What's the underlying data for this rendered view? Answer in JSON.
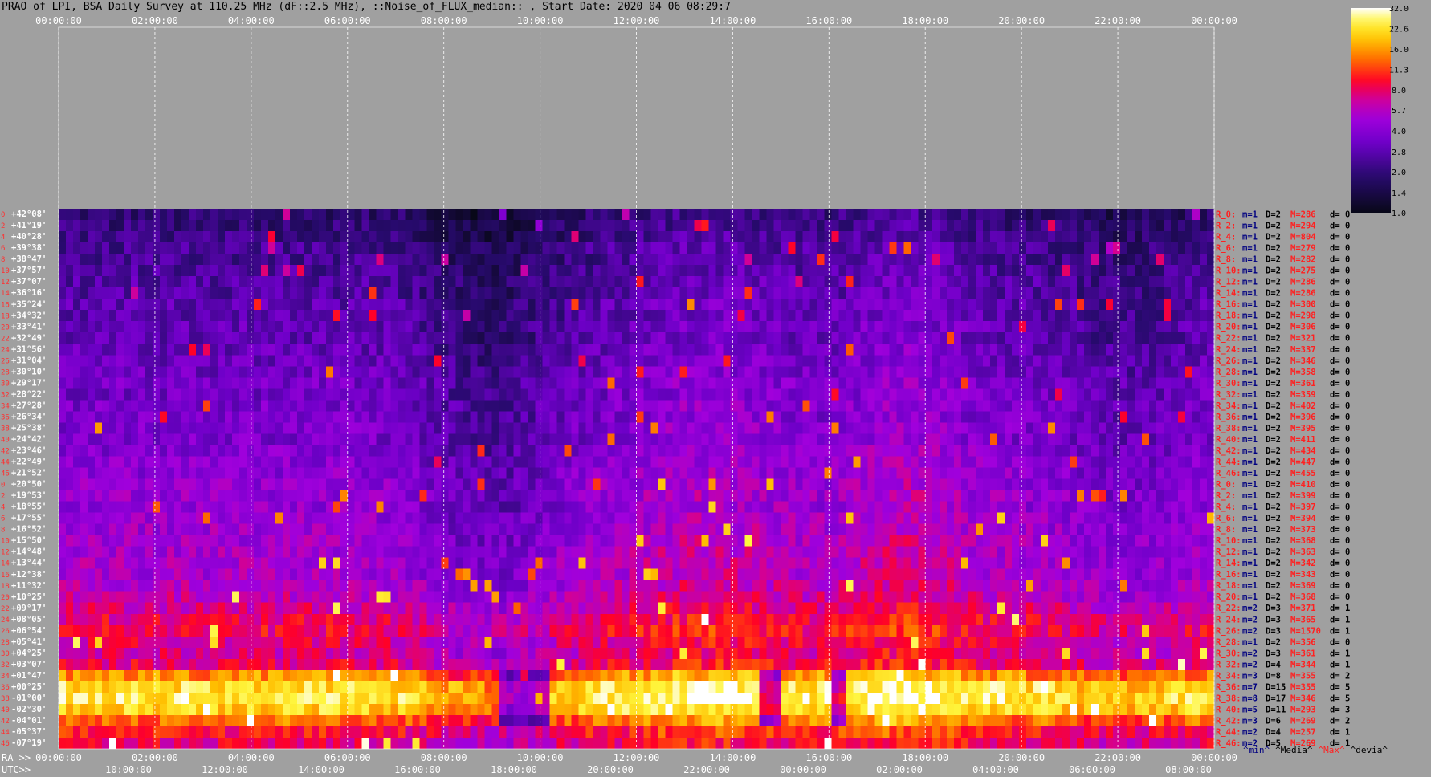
{
  "title": "PRAO of LPI, BSA Daily Survey at 110.25 MHz (dF::2.5 MHz), ::Noise_of_FLUX_median:: , Start Date: 2020 04 06 08:29:7",
  "chart_data": {
    "type": "heatmap",
    "top_axis_ticks": [
      "00:00:00",
      "02:00:00",
      "04:00:00",
      "06:00:00",
      "08:00:00",
      "10:00:00",
      "12:00:00",
      "14:00:00",
      "16:00:00",
      "18:00:00",
      "20:00:00",
      "22:00:00",
      "00:00:00"
    ],
    "ra_label": "RA >>",
    "ra_ticks": [
      "00:00:00",
      "02:00:00",
      "04:00:00",
      "06:00:00",
      "08:00:00",
      "10:00:00",
      "12:00:00",
      "14:00:00",
      "16:00:00",
      "18:00:00",
      "20:00:00",
      "22:00:00",
      "00:00:00"
    ],
    "utc_label": "UTC>>",
    "utc_ticks": [
      "10:00:00",
      "12:00:00",
      "14:00:00",
      "16:00:00",
      "18:00:00",
      "20:00:00",
      "22:00:00",
      "00:00:00",
      "02:00:00",
      "04:00:00",
      "06:00:00",
      "08:00:00"
    ],
    "declinations": [
      "+42°08'",
      "+41°19'",
      "+40°28'",
      "+39°38'",
      "+38°47'",
      "+37°57'",
      "+37°07'",
      "+36°16'",
      "+35°24'",
      "+34°32'",
      "+33°41'",
      "+32°49'",
      "+31°56'",
      "+31°04'",
      "+30°10'",
      "+29°17'",
      "+28°22'",
      "+27°28'",
      "+26°34'",
      "+25°38'",
      "+24°42'",
      "+23°46'",
      "+22°49'",
      "+21°52'",
      "+20°50'",
      "+19°53'",
      "+18°55'",
      "+17°55'",
      "+16°52'",
      "+15°50'",
      "+14°48'",
      "+13°44'",
      "+12°38'",
      "+11°32'",
      "+10°25'",
      "+09°17'",
      "+08°05'",
      "+06°54'",
      "+05°41'",
      "+04°25'",
      "+03°07'",
      "+01°47'",
      "+00°25'",
      "-01°00'",
      "-02°30'",
      "-04°01'",
      "-05°37'",
      "-07°19'"
    ],
    "row_indices": [
      "0",
      "2",
      "4",
      "6",
      "8",
      "10",
      "12",
      "14",
      "16",
      "18",
      "20",
      "22",
      "24",
      "26",
      "28",
      "30",
      "32",
      "34",
      "36",
      "38",
      "40",
      "42",
      "44",
      "46",
      "0",
      "2",
      "4",
      "6",
      "8",
      "10",
      "12",
      "14",
      "16",
      "18",
      "20",
      "22",
      "24",
      "26",
      "28",
      "30",
      "32",
      "34",
      "36",
      "38",
      "40",
      "42",
      "44",
      "46"
    ],
    "right_labels": [
      {
        "r": "R_0:",
        "m": "m=1",
        "D": "D=2",
        "M": "M=286",
        "d": "d= 0"
      },
      {
        "r": "R_2:",
        "m": "m=1",
        "D": "D=2",
        "M": "M=294",
        "d": "d= 0"
      },
      {
        "r": "R_4:",
        "m": "m=1",
        "D": "D=2",
        "M": "M=804",
        "d": "d= 0"
      },
      {
        "r": "R_6:",
        "m": "m=1",
        "D": "D=2",
        "M": "M=279",
        "d": "d= 0"
      },
      {
        "r": "R_8:",
        "m": "m=1",
        "D": "D=2",
        "M": "M=282",
        "d": "d= 0"
      },
      {
        "r": "R_10:",
        "m": "m=1",
        "D": "D=2",
        "M": "M=275",
        "d": "d= 0"
      },
      {
        "r": "R_12:",
        "m": "m=1",
        "D": "D=2",
        "M": "M=286",
        "d": "d= 0"
      },
      {
        "r": "R_14:",
        "m": "m=1",
        "D": "D=2",
        "M": "M=286",
        "d": "d= 0"
      },
      {
        "r": "R_16:",
        "m": "m=1",
        "D": "D=2",
        "M": "M=300",
        "d": "d= 0"
      },
      {
        "r": "R_18:",
        "m": "m=1",
        "D": "D=2",
        "M": "M=298",
        "d": "d= 0"
      },
      {
        "r": "R_20:",
        "m": "m=1",
        "D": "D=2",
        "M": "M=306",
        "d": "d= 0"
      },
      {
        "r": "R_22:",
        "m": "m=1",
        "D": "D=2",
        "M": "M=321",
        "d": "d= 0"
      },
      {
        "r": "R_24:",
        "m": "m=1",
        "D": "D=2",
        "M": "M=337",
        "d": "d= 0"
      },
      {
        "r": "R_26:",
        "m": "m=1",
        "D": "D=2",
        "M": "M=346",
        "d": "d= 0"
      },
      {
        "r": "R_28:",
        "m": "m=1",
        "D": "D=2",
        "M": "M=358",
        "d": "d= 0"
      },
      {
        "r": "R_30:",
        "m": "m=1",
        "D": "D=2",
        "M": "M=361",
        "d": "d= 0"
      },
      {
        "r": "R_32:",
        "m": "m=1",
        "D": "D=2",
        "M": "M=359",
        "d": "d= 0"
      },
      {
        "r": "R_34:",
        "m": "m=1",
        "D": "D=2",
        "M": "M=402",
        "d": "d= 0"
      },
      {
        "r": "R_36:",
        "m": "m=1",
        "D": "D=2",
        "M": "M=396",
        "d": "d= 0"
      },
      {
        "r": "R_38:",
        "m": "m=1",
        "D": "D=2",
        "M": "M=395",
        "d": "d= 0"
      },
      {
        "r": "R_40:",
        "m": "m=1",
        "D": "D=2",
        "M": "M=411",
        "d": "d= 0"
      },
      {
        "r": "R_42:",
        "m": "m=1",
        "D": "D=2",
        "M": "M=434",
        "d": "d= 0"
      },
      {
        "r": "R_44:",
        "m": "m=1",
        "D": "D=2",
        "M": "M=447",
        "d": "d= 0"
      },
      {
        "r": "R_46:",
        "m": "m=1",
        "D": "D=2",
        "M": "M=455",
        "d": "d= 0"
      },
      {
        "r": "R_0:",
        "m": "m=1",
        "D": "D=2",
        "M": "M=410",
        "d": "d= 0"
      },
      {
        "r": "R_2:",
        "m": "m=1",
        "D": "D=2",
        "M": "M=399",
        "d": "d= 0"
      },
      {
        "r": "R_4:",
        "m": "m=1",
        "D": "D=2",
        "M": "M=397",
        "d": "d= 0"
      },
      {
        "r": "R_6:",
        "m": "m=1",
        "D": "D=2",
        "M": "M=394",
        "d": "d= 0"
      },
      {
        "r": "R_8:",
        "m": "m=1",
        "D": "D=2",
        "M": "M=373",
        "d": "d= 0"
      },
      {
        "r": "R_10:",
        "m": "m=1",
        "D": "D=2",
        "M": "M=368",
        "d": "d= 0"
      },
      {
        "r": "R_12:",
        "m": "m=1",
        "D": "D=2",
        "M": "M=363",
        "d": "d= 0"
      },
      {
        "r": "R_14:",
        "m": "m=1",
        "D": "D=2",
        "M": "M=342",
        "d": "d= 0"
      },
      {
        "r": "R_16:",
        "m": "m=1",
        "D": "D=2",
        "M": "M=343",
        "d": "d= 0"
      },
      {
        "r": "R_18:",
        "m": "m=1",
        "D": "D=2",
        "M": "M=369",
        "d": "d= 0"
      },
      {
        "r": "R_20:",
        "m": "m=1",
        "D": "D=2",
        "M": "M=368",
        "d": "d= 0"
      },
      {
        "r": "R_22:",
        "m": "m=2",
        "D": "D=3",
        "M": "M=371",
        "d": "d= 1"
      },
      {
        "r": "R_24:",
        "m": "m=2",
        "D": "D=3",
        "M": "M=365",
        "d": "d= 1"
      },
      {
        "r": "R_26:",
        "m": "m=2",
        "D": "D=3",
        "M": "M=1570",
        "d": "d= 1"
      },
      {
        "r": "R_28:",
        "m": "m=1",
        "D": "D=2",
        "M": "M=356",
        "d": "d= 0"
      },
      {
        "r": "R_30:",
        "m": "m=2",
        "D": "D=3",
        "M": "M=361",
        "d": "d= 1"
      },
      {
        "r": "R_32:",
        "m": "m=2",
        "D": "D=4",
        "M": "M=344",
        "d": "d= 1"
      },
      {
        "r": "R_34:",
        "m": "m=3",
        "D": "D=8",
        "M": "M=355",
        "d": "d= 2"
      },
      {
        "r": "R_36:",
        "m": "m=7",
        "D": "D=15",
        "M": "M=355",
        "d": "d= 5"
      },
      {
        "r": "R_38:",
        "m": "m=8",
        "D": "D=17",
        "M": "M=346",
        "d": "d= 5"
      },
      {
        "r": "R_40:",
        "m": "m=5",
        "D": "D=11",
        "M": "M=293",
        "d": "d= 3"
      },
      {
        "r": "R_42:",
        "m": "m=3",
        "D": "D=6",
        "M": "M=269",
        "d": "d= 2"
      },
      {
        "r": "R_44:",
        "m": "m=2",
        "D": "D=4",
        "M": "M=257",
        "d": "d= 1"
      },
      {
        "r": "R_46:",
        "m": "m=2",
        "D": "D=5",
        "M": "M=269",
        "d": "d= 1"
      }
    ],
    "colorbar_ticks": [
      "32.0",
      "22.6",
      "16.0",
      "11.3",
      "8.0",
      "5.7",
      "4.0",
      "2.8",
      "2.0",
      "1.4",
      "1.0"
    ],
    "colorbar_range": [
      1.0,
      32.0
    ],
    "colorbar_scale": "log",
    "heat_levels": [
      0.18,
      0.2,
      0.22,
      0.25,
      0.24,
      0.26,
      0.28,
      0.27,
      0.3,
      0.29,
      0.31,
      0.3,
      0.32,
      0.33,
      0.34,
      0.36,
      0.35,
      0.37,
      0.36,
      0.38,
      0.37,
      0.39,
      0.4,
      0.41,
      0.42,
      0.43,
      0.42,
      0.44,
      0.45,
      0.46,
      0.47,
      0.48,
      0.47,
      0.5,
      0.52,
      0.56,
      0.6,
      0.62,
      0.58,
      0.56,
      0.6,
      0.78,
      0.9,
      0.92,
      0.88,
      0.75,
      0.65,
      0.6
    ],
    "colors": {
      "background": "#a0a0a0",
      "grid": "#ffffff",
      "title": "#000000",
      "declination_text": "#ffffff",
      "row_index": "#ff3030",
      "stat_r": "#ff2020",
      "stat_m": "#000080",
      "stat_D": "#000000",
      "stat_M": "#ff2020",
      "stat_d": "#000000",
      "colorbar_ticks": "#000000"
    },
    "footer_legend": [
      {
        "text": "^min^",
        "color": "#000080"
      },
      {
        "text": "^Media^",
        "color": "#000000"
      },
      {
        "text": "^Max^",
        "color": "#ff2020"
      },
      {
        "text": "^devia^",
        "color": "#000000"
      }
    ]
  }
}
